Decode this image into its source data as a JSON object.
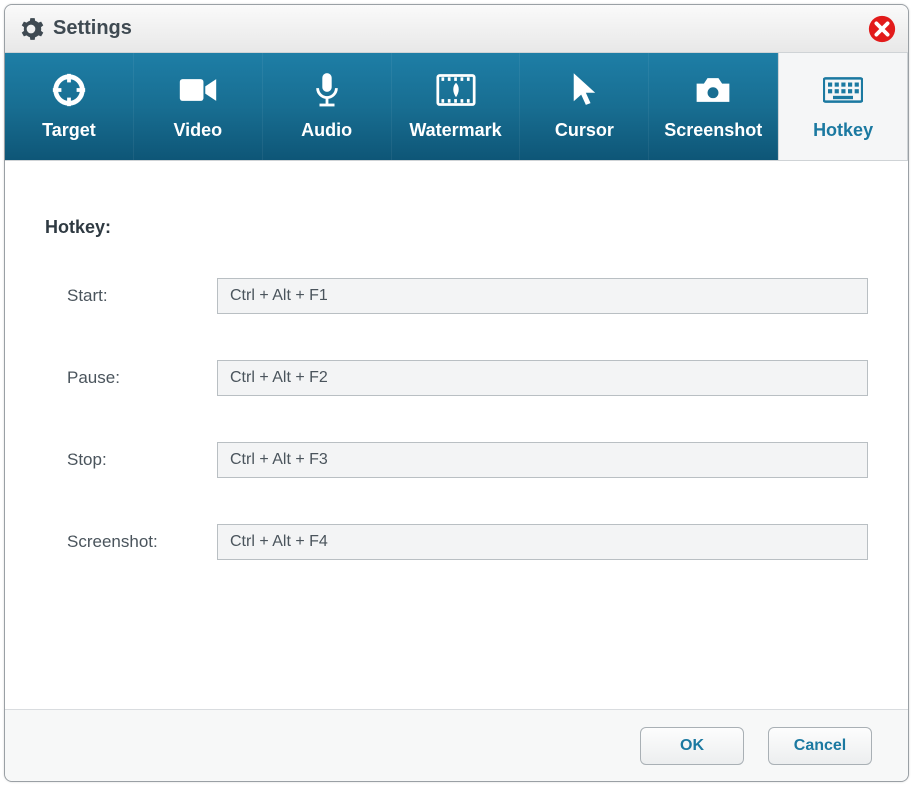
{
  "window": {
    "title": "Settings"
  },
  "tabs": {
    "target": "Target",
    "video": "Video",
    "audio": "Audio",
    "watermark": "Watermark",
    "cursor": "Cursor",
    "screenshot": "Screenshot",
    "hotkey": "Hotkey"
  },
  "hotkey": {
    "section_label": "Hotkey:",
    "rows": {
      "start": {
        "label": "Start:",
        "value": "Ctrl + Alt + F1"
      },
      "pause": {
        "label": "Pause:",
        "value": "Ctrl + Alt + F2"
      },
      "stop": {
        "label": "Stop:",
        "value": "Ctrl + Alt + F3"
      },
      "screenshot": {
        "label": "Screenshot:",
        "value": "Ctrl + Alt + F4"
      }
    }
  },
  "footer": {
    "ok": "OK",
    "cancel": "Cancel"
  },
  "colors": {
    "accent": "#1b79a1",
    "close": "#e21b1b"
  }
}
